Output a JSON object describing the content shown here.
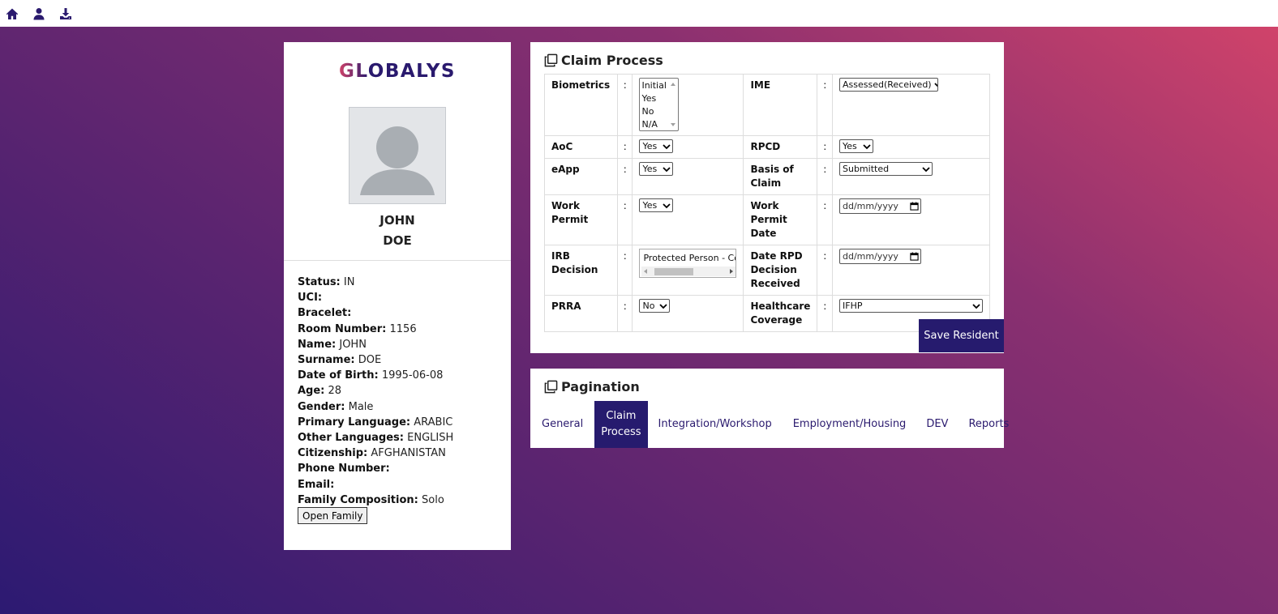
{
  "topbar": {
    "icons": [
      "home-icon",
      "user-icon",
      "download-icon"
    ]
  },
  "profile": {
    "logo_text": "GLOBALYS",
    "first_name": "JOHN",
    "last_name": "DOE",
    "fields": [
      {
        "label": "Status:",
        "value": "IN"
      },
      {
        "label": "UCI:",
        "value": ""
      },
      {
        "label": "Bracelet:",
        "value": ""
      },
      {
        "label": "Room Number:",
        "value": "1156"
      },
      {
        "label": "Name:",
        "value": "JOHN"
      },
      {
        "label": "Surname:",
        "value": "DOE"
      },
      {
        "label": "Date of Birth:",
        "value": "1995-06-08"
      },
      {
        "label": "Age:",
        "value": "28"
      },
      {
        "label": "Gender:",
        "value": "Male"
      },
      {
        "label": "Primary Language:",
        "value": "ARABIC"
      },
      {
        "label": "Other Languages:",
        "value": "ENGLISH"
      },
      {
        "label": "Citizenship:",
        "value": "AFGHANISTAN"
      },
      {
        "label": "Phone Number:",
        "value": ""
      },
      {
        "label": "Email:",
        "value": ""
      },
      {
        "label": "Family Composition:",
        "value": "Solo"
      }
    ],
    "open_family_label": "Open Family"
  },
  "claim_process": {
    "title": "Claim Process",
    "colon": ":",
    "biometrics": {
      "label": "Biometrics",
      "options": [
        "Initial",
        "Yes",
        "No",
        "N/A"
      ]
    },
    "ime": {
      "label": "IME",
      "value": "Assessed(Received)"
    },
    "aoc": {
      "label": "AoC",
      "value": "Yes"
    },
    "rpcd": {
      "label": "RPCD",
      "value": "Yes"
    },
    "eapp": {
      "label": "eApp",
      "value": "Yes"
    },
    "basis_of_claim": {
      "label": "Basis of Claim",
      "value": "Submitted"
    },
    "work_permit": {
      "label": "Work Permit",
      "value": "Yes"
    },
    "work_permit_date": {
      "label": "Work Permit Date",
      "placeholder": "dd/mm/yyyy"
    },
    "irb_decision": {
      "label": "IRB Decision",
      "value": "Protected Person - Con"
    },
    "date_rpd": {
      "label": "Date RPD Decision Received",
      "placeholder": "dd/mm/yyyy"
    },
    "prra": {
      "label": "PRRA",
      "value": "No"
    },
    "healthcare": {
      "label": "Healthcare Coverage",
      "value": "IFHP"
    },
    "save_label": "Save Resident"
  },
  "pagination": {
    "title": "Pagination",
    "tabs": [
      "General",
      "Claim Process",
      "Integration/Workshop",
      "Employment/Housing",
      "DEV",
      "Reports"
    ],
    "active_tab": "Claim Process"
  }
}
